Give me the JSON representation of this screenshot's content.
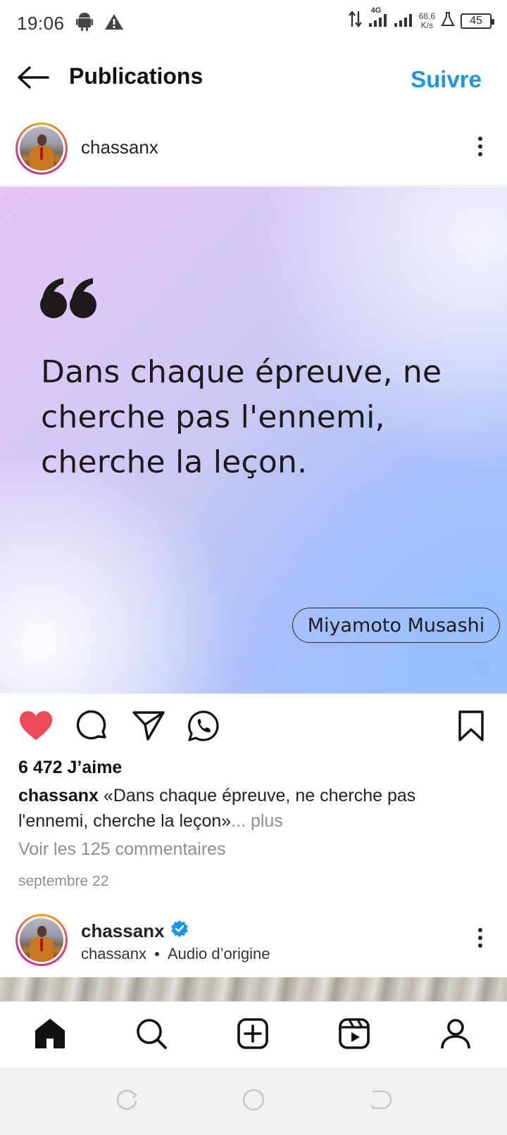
{
  "status_bar": {
    "time": "19:06",
    "network_type": "4G",
    "speed_value": "68,6",
    "speed_unit": "K/s",
    "battery": "45"
  },
  "header": {
    "title": "Publications",
    "follow_label": "Suivre",
    "accent_color": "#1a96e8"
  },
  "post": {
    "author": "chassanx",
    "quote_lines": [
      "Dans chaque épreuve, ne",
      "cherche pas l'ennemi,",
      "cherche la leçon."
    ],
    "quote_author": "Miyamoto Musashi",
    "likes": "6 472 J’aime",
    "caption_user": "chassanx",
    "caption_text": " «Dans chaque épreuve, ne cherche pas l'ennemi, cherche la leçon»",
    "caption_more": "... plus",
    "comments_link": "Voir les 125 commentaires",
    "date": "septembre 22",
    "liked": true,
    "like_color": "#ed4956"
  },
  "next_post": {
    "author": "chassanx",
    "verified": true,
    "sub_user": "chassanx",
    "audio": "Audio d’origine"
  },
  "bottom_nav": {
    "items": [
      "home-icon",
      "search-icon",
      "create-icon",
      "reels-icon",
      "profile-icon"
    ]
  }
}
